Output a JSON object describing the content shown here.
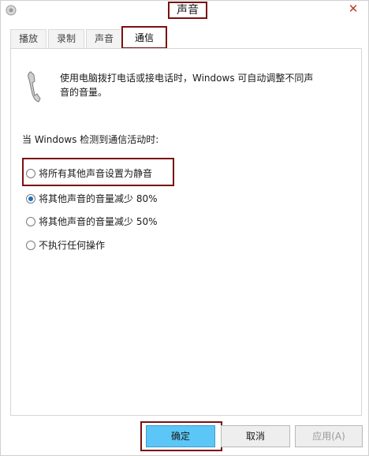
{
  "window": {
    "title": "声音",
    "close_glyph": "✕"
  },
  "tabs": [
    {
      "label": "播放"
    },
    {
      "label": "录制"
    },
    {
      "label": "声音"
    },
    {
      "label": "通信"
    }
  ],
  "active_tab": "通信",
  "panel": {
    "description": "使用电脑拨打电话或接电话时，Windows 可自动调整不同声音的音量。",
    "heading": "当 Windows 检测到通信活动时:",
    "options": [
      {
        "label": "将所有其他声音设置为静音",
        "checked": false
      },
      {
        "label": "将其他声音的音量减少 80%",
        "checked": true
      },
      {
        "label": "将其他声音的音量减少 50%",
        "checked": false
      },
      {
        "label": "不执行任何操作",
        "checked": false
      }
    ]
  },
  "footer": {
    "ok_label": "确定",
    "cancel_label": "取消",
    "apply_label": "应用(A)"
  },
  "icons": {
    "app": "speaker-icon",
    "phone": "phone-icon"
  }
}
